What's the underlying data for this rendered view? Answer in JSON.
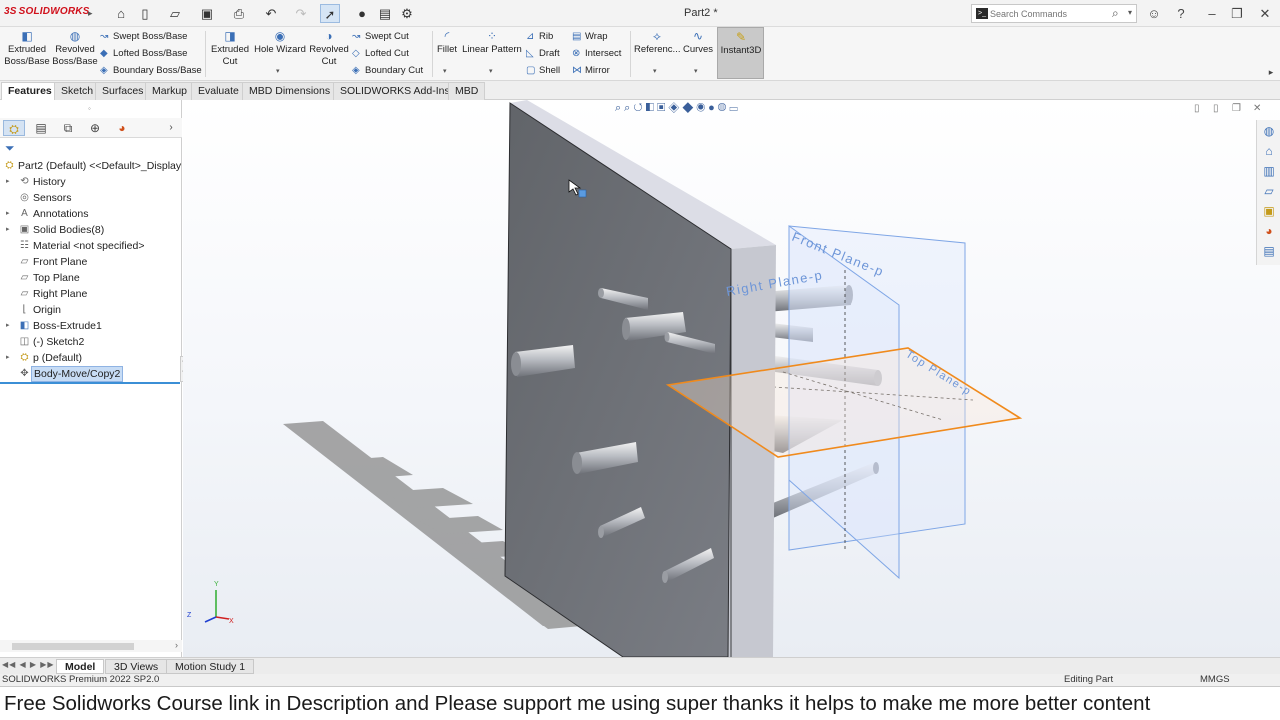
{
  "app": {
    "logo_text": "SOLIDWORKS",
    "title": "Part2 *"
  },
  "search": {
    "placeholder": "Search Commands"
  },
  "colors": {
    "accent": "#3b6fb6",
    "plane_orange": "#f08a1c",
    "plane_blue": "#7fa6e6",
    "part_gray": "#6e7178"
  },
  "ribbon": {
    "big": [
      {
        "label": "Extruded\nBoss/Base",
        "icon": "extruded-boss-icon"
      },
      {
        "label": "Revolved\nBoss/Base",
        "icon": "revolved-boss-icon"
      },
      {
        "label": "Extruded\nCut",
        "icon": "extruded-cut-icon"
      },
      {
        "label": "Hole Wizard",
        "icon": "hole-wizard-icon"
      },
      {
        "label": "Revolved\nCut",
        "icon": "revolved-cut-icon"
      },
      {
        "label": "Fillet",
        "icon": "fillet-icon"
      },
      {
        "label": "Linear Pattern",
        "icon": "linear-pattern-icon"
      },
      {
        "label": "Referenc...",
        "icon": "reference-geometry-icon"
      },
      {
        "label": "Curves",
        "icon": "curves-icon"
      },
      {
        "label": "Instant3D",
        "icon": "instant3d-icon"
      }
    ],
    "small": [
      "Swept Boss/Base",
      "Lofted Boss/Base",
      "Boundary Boss/Base",
      "Swept Cut",
      "Lofted Cut",
      "Boundary Cut",
      "Rib",
      "Draft",
      "Shell",
      "Wrap",
      "Intersect",
      "Mirror"
    ]
  },
  "tabs": [
    "Features",
    "Sketch",
    "Surfaces",
    "Markup",
    "Evaluate",
    "MBD Dimensions",
    "SOLIDWORKS Add-Ins",
    "MBD"
  ],
  "tree": [
    {
      "label": "Part2 (Default) <<Default>_Display S",
      "icon": "part-icon"
    },
    {
      "label": "History",
      "icon": "history-icon"
    },
    {
      "label": "Sensors",
      "icon": "sensors-icon"
    },
    {
      "label": "Annotations",
      "icon": "annotations-icon"
    },
    {
      "label": "Solid Bodies(8)",
      "icon": "solid-bodies-icon"
    },
    {
      "label": "Material <not specified>",
      "icon": "material-icon"
    },
    {
      "label": "Front Plane",
      "icon": "plane-icon"
    },
    {
      "label": "Top Plane",
      "icon": "plane-icon"
    },
    {
      "label": "Right Plane",
      "icon": "plane-icon"
    },
    {
      "label": "Origin",
      "icon": "origin-icon"
    },
    {
      "label": "Boss-Extrude1",
      "icon": "extrude-icon"
    },
    {
      "label": "(-) Sketch2",
      "icon": "sketch-icon"
    },
    {
      "label": "p (Default)",
      "icon": "part-icon"
    },
    {
      "label": "Body-Move/Copy2",
      "icon": "move-copy-icon"
    }
  ],
  "viewport": {
    "plane_labels": {
      "front": "Front Plane-p",
      "right": "Right Plane-p",
      "top": "Top Plane-p"
    },
    "triad": {
      "x": "X",
      "y": "Y",
      "z": "Z"
    }
  },
  "bottom_tabs": [
    "Model",
    "3D Views",
    "Motion Study 1"
  ],
  "status": {
    "left": "SOLIDWORKS Premium 2022 SP2.0",
    "mid": "Editing Part",
    "units": "MMGS"
  },
  "caption": "Free Solidworks Course link in Description and Please support  me using super thanks it helps to make me more better content"
}
